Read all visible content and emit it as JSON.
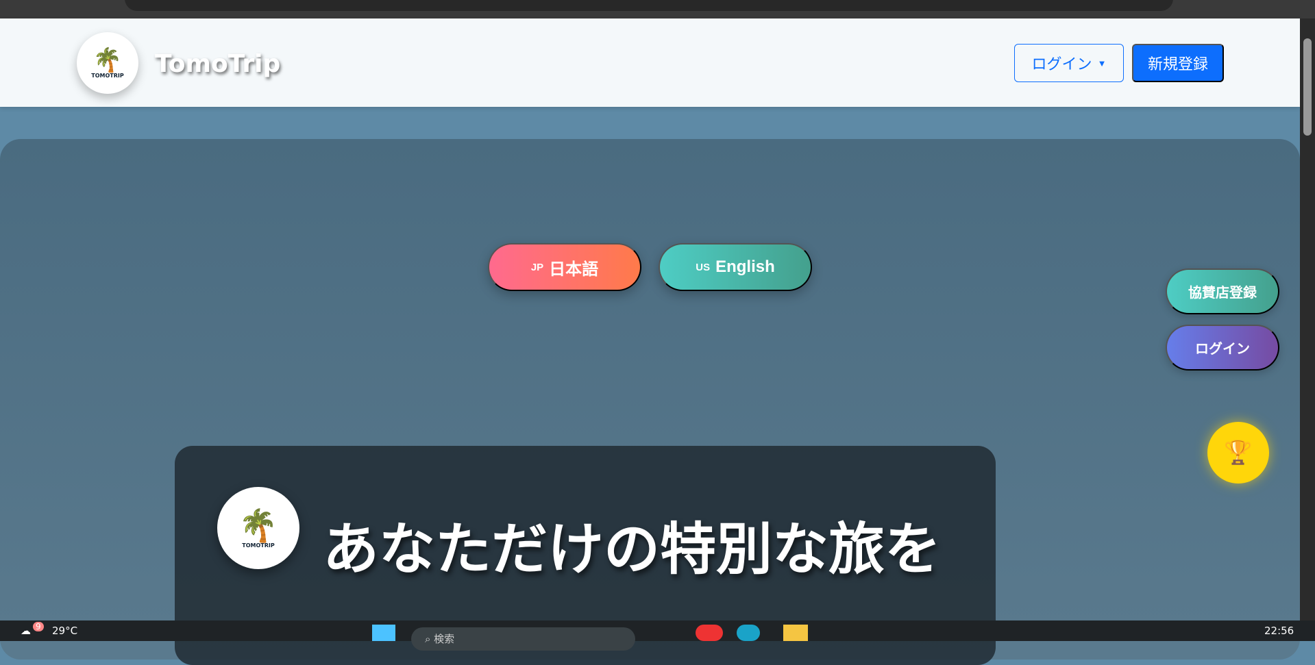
{
  "header": {
    "brand": "TomoTrip",
    "logo_text": "TOMOTRIP",
    "login_label": "ログイン",
    "register_label": "新規登録"
  },
  "language": {
    "jp_flag": "JP",
    "jp_label": "日本語",
    "us_flag": "US",
    "en_label": "English"
  },
  "floating": {
    "sponsor_label": "協賛店登録",
    "login_label": "ログイン",
    "trophy_icon": "🏆"
  },
  "hero": {
    "title": "あなただけの特別な旅を",
    "logo_text": "TOMOTRIP"
  },
  "taskbar": {
    "weather_badge": "9",
    "temperature": "29°C",
    "search_placeholder": "検索",
    "time": "22:56"
  }
}
